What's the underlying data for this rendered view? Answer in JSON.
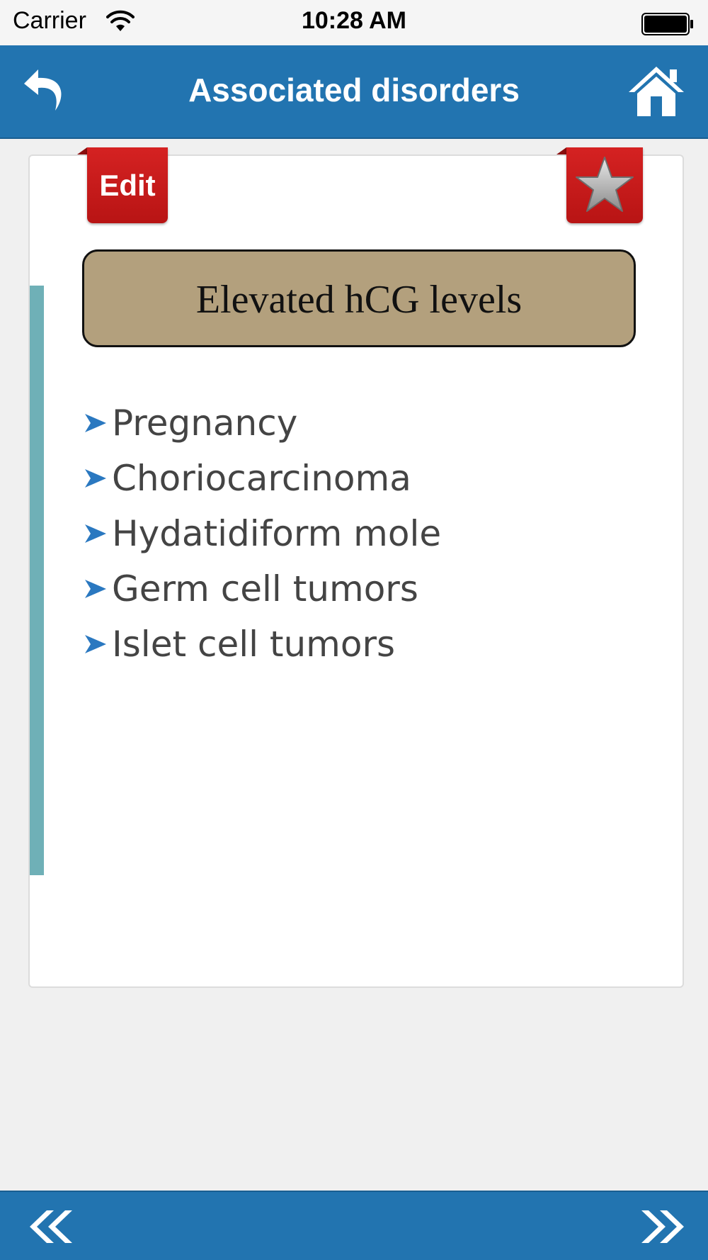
{
  "status_bar": {
    "carrier": "Carrier",
    "time": "10:28 AM"
  },
  "nav_bar": {
    "title": "Associated disorders",
    "back_icon": "back-arrow-icon",
    "home_icon": "home-icon"
  },
  "card": {
    "edit_label": "Edit",
    "favorite_icon": "star-icon",
    "heading": "Elevated hCG levels",
    "items": [
      {
        "label": "Pregnancy"
      },
      {
        "label": "Choriocarcinoma"
      },
      {
        "label": "Hydatidiform mole"
      },
      {
        "label": "Germ cell tumors"
      },
      {
        "label": "Islet cell tumors"
      }
    ]
  },
  "bottom_bar": {
    "prev_icon": "double-chevron-left-icon",
    "next_icon": "double-chevron-right-icon"
  },
  "colors": {
    "bar_blue": "#2274b0",
    "ribbon_red": "#c81a1a",
    "heading_tan": "#b3a07d",
    "accent_teal": "#6fb0b7",
    "bullet_blue": "#2a78c0",
    "list_text": "#444444"
  }
}
